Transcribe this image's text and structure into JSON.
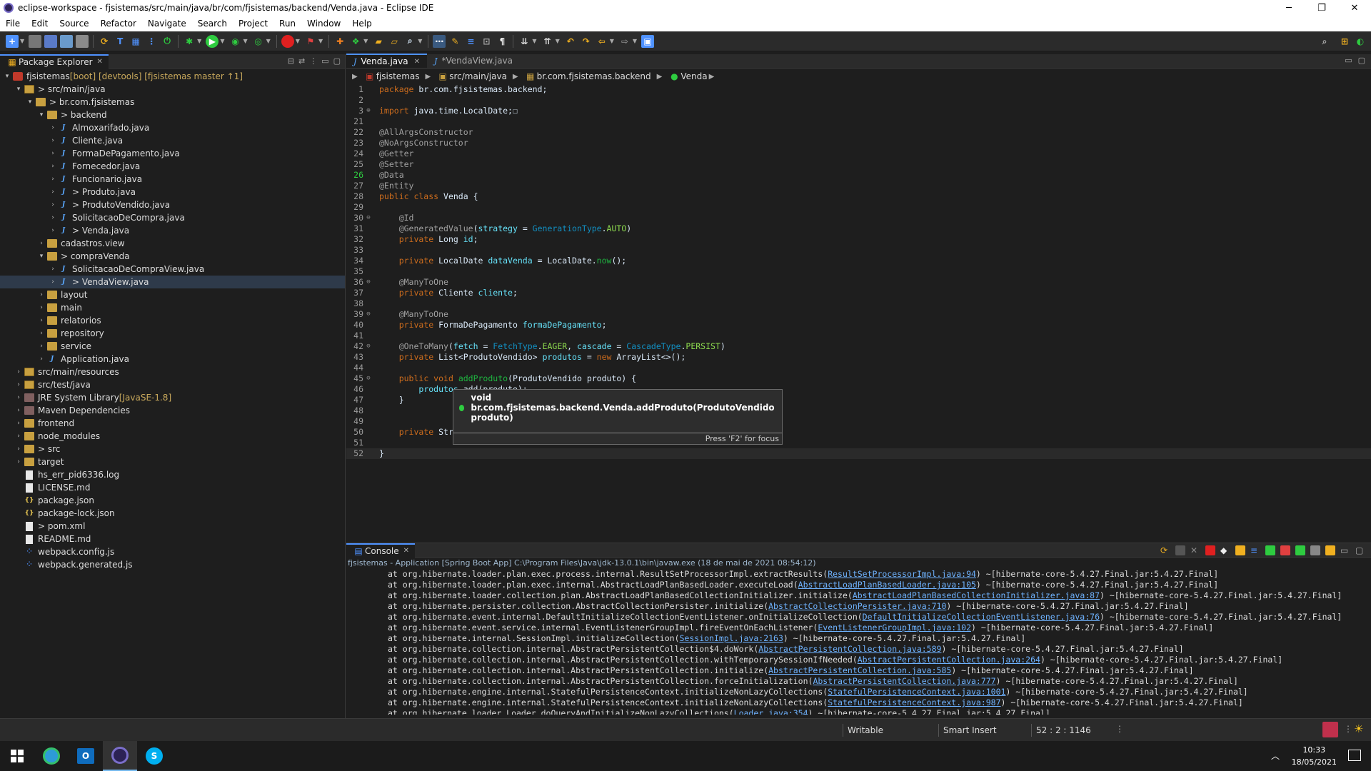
{
  "window": {
    "title": "eclipse-workspace - fjsistemas/src/main/java/br/com/fjsistemas/backend/Venda.java - Eclipse IDE",
    "minimize": "─",
    "maximize": "❐",
    "close": "✕"
  },
  "menu": [
    "File",
    "Edit",
    "Source",
    "Refactor",
    "Navigate",
    "Search",
    "Project",
    "Run",
    "Window",
    "Help"
  ],
  "package_explorer": {
    "title": "Package Explorer",
    "tree": [
      {
        "label": "fjsistemas",
        "deco": " [boot] [devtools] [fjsistemas master ↑1]",
        "icon": "project",
        "arrow": "▾",
        "indent": 0
      },
      {
        "label": "> src/main/java",
        "deco": "",
        "icon": "srcfolder",
        "arrow": "▾",
        "indent": 1
      },
      {
        "label": "> br.com.fjsistemas",
        "deco": "",
        "icon": "package",
        "arrow": "▾",
        "indent": 2
      },
      {
        "label": "> backend",
        "deco": "",
        "icon": "package",
        "arrow": "▾",
        "indent": 3
      },
      {
        "label": "Almoxarifado.java",
        "deco": "",
        "icon": "java",
        "arrow": "›",
        "indent": 4
      },
      {
        "label": "Cliente.java",
        "deco": "",
        "icon": "java",
        "arrow": "›",
        "indent": 4
      },
      {
        "label": "FormaDePagamento.java",
        "deco": "",
        "icon": "java",
        "arrow": "›",
        "indent": 4
      },
      {
        "label": "Fornecedor.java",
        "deco": "",
        "icon": "java",
        "arrow": "›",
        "indent": 4
      },
      {
        "label": "Funcionario.java",
        "deco": "",
        "icon": "java",
        "arrow": "›",
        "indent": 4
      },
      {
        "label": "> Produto.java",
        "deco": "",
        "icon": "java",
        "arrow": "›",
        "indent": 4
      },
      {
        "label": "> ProdutoVendido.java",
        "deco": "",
        "icon": "java",
        "arrow": "›",
        "indent": 4
      },
      {
        "label": "SolicitacaoDeCompra.java",
        "deco": "",
        "icon": "java",
        "arrow": "›",
        "indent": 4
      },
      {
        "label": "> Venda.java",
        "deco": "",
        "icon": "java",
        "arrow": "›",
        "indent": 4
      },
      {
        "label": "cadastros.view",
        "deco": "",
        "icon": "package",
        "arrow": "›",
        "indent": 3
      },
      {
        "label": "> compraVenda",
        "deco": "",
        "icon": "package",
        "arrow": "▾",
        "indent": 3
      },
      {
        "label": "SolicitacaoDeCompraView.java",
        "deco": "",
        "icon": "java",
        "arrow": "›",
        "indent": 4
      },
      {
        "label": "> VendaView.java",
        "deco": "",
        "icon": "java",
        "arrow": "›",
        "indent": 4,
        "selected": true
      },
      {
        "label": "layout",
        "deco": "",
        "icon": "package",
        "arrow": "›",
        "indent": 3
      },
      {
        "label": "main",
        "deco": "",
        "icon": "package",
        "arrow": "›",
        "indent": 3
      },
      {
        "label": "relatorios",
        "deco": "",
        "icon": "package",
        "arrow": "›",
        "indent": 3
      },
      {
        "label": "repository",
        "deco": "",
        "icon": "package",
        "arrow": "›",
        "indent": 3
      },
      {
        "label": "service",
        "deco": "",
        "icon": "package",
        "arrow": "›",
        "indent": 3
      },
      {
        "label": "Application.java",
        "deco": "",
        "icon": "java",
        "arrow": "›",
        "indent": 3
      },
      {
        "label": "src/main/resources",
        "deco": "",
        "icon": "srcfolder",
        "arrow": "›",
        "indent": 1
      },
      {
        "label": "src/test/java",
        "deco": "",
        "icon": "srcfolder",
        "arrow": "›",
        "indent": 1
      },
      {
        "label": "JRE System Library",
        "deco": " [JavaSE-1.8]",
        "icon": "library",
        "arrow": "›",
        "indent": 1
      },
      {
        "label": "Maven Dependencies",
        "deco": "",
        "icon": "library",
        "arrow": "›",
        "indent": 1
      },
      {
        "label": "frontend",
        "deco": "",
        "icon": "folder",
        "arrow": "›",
        "indent": 1
      },
      {
        "label": "node_modules",
        "deco": "",
        "icon": "folder",
        "arrow": "›",
        "indent": 1
      },
      {
        "label": "> src",
        "deco": "",
        "icon": "folder",
        "arrow": "›",
        "indent": 1
      },
      {
        "label": "target",
        "deco": "",
        "icon": "folder",
        "arrow": "›",
        "indent": 1
      },
      {
        "label": "hs_err_pid6336.log",
        "deco": "",
        "icon": "file",
        "arrow": "",
        "indent": 1
      },
      {
        "label": "LICENSE.md",
        "deco": "",
        "icon": "file",
        "arrow": "",
        "indent": 1
      },
      {
        "label": "package.json",
        "deco": "",
        "icon": "json",
        "arrow": "",
        "indent": 1
      },
      {
        "label": "package-lock.json",
        "deco": "",
        "icon": "json",
        "arrow": "",
        "indent": 1
      },
      {
        "label": "> pom.xml",
        "deco": "",
        "icon": "file",
        "arrow": "",
        "indent": 1
      },
      {
        "label": "README.md",
        "deco": "",
        "icon": "file",
        "arrow": "",
        "indent": 1
      },
      {
        "label": "webpack.config.js",
        "deco": "",
        "icon": "js",
        "arrow": "",
        "indent": 1
      },
      {
        "label": "webpack.generated.js",
        "deco": "",
        "icon": "js",
        "arrow": "",
        "indent": 1
      }
    ]
  },
  "editor": {
    "tabs": [
      {
        "label": "Venda.java",
        "active": true,
        "closable": true
      },
      {
        "label": "*VendaView.java",
        "active": false,
        "closable": false
      }
    ],
    "breadcrumb": [
      "fjsistemas",
      "src/main/java",
      "br.com.fjsistemas.backend",
      "Venda"
    ],
    "lines": [
      {
        "n": "1",
        "fold": "",
        "tokens": [
          [
            "kw",
            "package"
          ],
          [
            "pl",
            " br.com.fjsistemas.backend;"
          ]
        ]
      },
      {
        "n": "2",
        "fold": "",
        "tokens": []
      },
      {
        "n": "3",
        "fold": "⊕",
        "tokens": [
          [
            "kw",
            "import"
          ],
          [
            "pl",
            " java.time.LocalDate;"
          ],
          [
            "pl",
            "☐"
          ]
        ]
      },
      {
        "n": "21",
        "fold": "",
        "tokens": []
      },
      {
        "n": "22",
        "fold": "",
        "tokens": [
          [
            "an",
            "@AllArgsConstructor"
          ]
        ]
      },
      {
        "n": "23",
        "fold": "",
        "tokens": [
          [
            "an",
            "@NoArgsConstructor"
          ]
        ]
      },
      {
        "n": "24",
        "fold": "",
        "tokens": [
          [
            "an",
            "@Getter"
          ]
        ]
      },
      {
        "n": "25",
        "fold": "",
        "tokens": [
          [
            "an",
            "@Setter"
          ]
        ]
      },
      {
        "n": "26",
        "fold": "",
        "marker": true,
        "tokens": [
          [
            "an",
            "@Data"
          ]
        ]
      },
      {
        "n": "27",
        "fold": "",
        "tokens": [
          [
            "an",
            "@Entity"
          ]
        ]
      },
      {
        "n": "28",
        "fold": "",
        "tokens": [
          [
            "kw",
            "public class"
          ],
          [
            "pl",
            " Venda "
          ],
          [
            "pl",
            "{"
          ]
        ]
      },
      {
        "n": "29",
        "fold": "",
        "tokens": []
      },
      {
        "n": "30",
        "fold": "⊖",
        "tokens": [
          [
            "pl",
            "    "
          ],
          [
            "an",
            "@Id"
          ]
        ]
      },
      {
        "n": "31",
        "fold": "",
        "tokens": [
          [
            "pl",
            "    "
          ],
          [
            "an",
            "@GeneratedValue"
          ],
          [
            "pl",
            "("
          ],
          [
            "fd",
            "strategy"
          ],
          [
            "pl",
            " = "
          ],
          [
            "ty",
            "GenerationType"
          ],
          [
            "pl",
            "."
          ],
          [
            "st",
            "AUTO"
          ],
          [
            "pl",
            ")"
          ]
        ]
      },
      {
        "n": "32",
        "fold": "",
        "tokens": [
          [
            "pl",
            "    "
          ],
          [
            "kw",
            "private"
          ],
          [
            "pl",
            " Long "
          ],
          [
            "fd",
            "id"
          ],
          [
            "pl",
            ";"
          ]
        ]
      },
      {
        "n": "33",
        "fold": "",
        "tokens": []
      },
      {
        "n": "34",
        "fold": "",
        "tokens": [
          [
            "pl",
            "    "
          ],
          [
            "kw",
            "private"
          ],
          [
            "pl",
            " LocalDate "
          ],
          [
            "fd",
            "dataVenda"
          ],
          [
            "pl",
            " = LocalDate."
          ],
          [
            "mt",
            "now"
          ],
          [
            "pl",
            "();"
          ]
        ]
      },
      {
        "n": "35",
        "fold": "",
        "tokens": []
      },
      {
        "n": "36",
        "fold": "⊖",
        "tokens": [
          [
            "pl",
            "    "
          ],
          [
            "an",
            "@ManyToOne"
          ]
        ]
      },
      {
        "n": "37",
        "fold": "",
        "tokens": [
          [
            "pl",
            "    "
          ],
          [
            "kw",
            "private"
          ],
          [
            "pl",
            " Cliente "
          ],
          [
            "fd",
            "cliente"
          ],
          [
            "pl",
            ";"
          ]
        ]
      },
      {
        "n": "38",
        "fold": "",
        "tokens": []
      },
      {
        "n": "39",
        "fold": "⊖",
        "tokens": [
          [
            "pl",
            "    "
          ],
          [
            "an",
            "@ManyToOne"
          ]
        ]
      },
      {
        "n": "40",
        "fold": "",
        "tokens": [
          [
            "pl",
            "    "
          ],
          [
            "kw",
            "private"
          ],
          [
            "pl",
            " FormaDePagamento "
          ],
          [
            "fd",
            "formaDePagamento"
          ],
          [
            "pl",
            ";"
          ]
        ]
      },
      {
        "n": "41",
        "fold": "",
        "tokens": []
      },
      {
        "n": "42",
        "fold": "⊖",
        "tokens": [
          [
            "pl",
            "    "
          ],
          [
            "an",
            "@OneToMany"
          ],
          [
            "pl",
            "("
          ],
          [
            "fd",
            "fetch"
          ],
          [
            "pl",
            " = "
          ],
          [
            "ty",
            "FetchType"
          ],
          [
            "pl",
            "."
          ],
          [
            "st",
            "EAGER"
          ],
          [
            "pl",
            ", "
          ],
          [
            "fd",
            "cascade"
          ],
          [
            "pl",
            " = "
          ],
          [
            "ty",
            "CascadeType"
          ],
          [
            "pl",
            "."
          ],
          [
            "st",
            "PERSIST"
          ],
          [
            "pl",
            ")"
          ]
        ]
      },
      {
        "n": "43",
        "fold": "",
        "tokens": [
          [
            "pl",
            "    "
          ],
          [
            "kw",
            "private"
          ],
          [
            "pl",
            " List<ProdutoVendido> "
          ],
          [
            "fd",
            "produtos"
          ],
          [
            "pl",
            " = "
          ],
          [
            "kw",
            "new"
          ],
          [
            "pl",
            " ArrayList<>();"
          ]
        ]
      },
      {
        "n": "44",
        "fold": "",
        "tokens": []
      },
      {
        "n": "45",
        "fold": "⊖",
        "tokens": [
          [
            "pl",
            "    "
          ],
          [
            "kw",
            "public void"
          ],
          [
            "pl",
            " "
          ],
          [
            "mt",
            "addProduto"
          ],
          [
            "pl",
            "(ProdutoVendido produto) {"
          ]
        ]
      },
      {
        "n": "46",
        "fold": "",
        "tokens": [
          [
            "pl",
            "        "
          ],
          [
            "fd",
            "produtos"
          ],
          [
            "pl",
            ".add(produto);"
          ]
        ]
      },
      {
        "n": "47",
        "fold": "",
        "tokens": [
          [
            "pl",
            "    }"
          ]
        ]
      },
      {
        "n": "48",
        "fold": "",
        "tokens": []
      },
      {
        "n": "49",
        "fold": "",
        "tokens": []
      },
      {
        "n": "50",
        "fold": "",
        "tokens": [
          [
            "pl",
            "    "
          ],
          [
            "kw",
            "private"
          ],
          [
            "pl",
            " String "
          ],
          [
            "fd",
            "obs"
          ],
          [
            "pl",
            ";"
          ]
        ]
      },
      {
        "n": "51",
        "fold": "",
        "tokens": []
      },
      {
        "n": "52",
        "fold": "",
        "current": true,
        "tokens": [
          [
            "pl",
            "}"
          ]
        ]
      }
    ],
    "hover": {
      "signature": "void br.com.fjsistemas.backend.Venda.addProduto(ProdutoVendido produto)",
      "footer": "Press 'F2' for focus"
    }
  },
  "console": {
    "title": "Console",
    "description": "fjsistemas - Application [Spring Boot App] C:\\Program Files\\Java\\jdk-13.0.1\\bin\\javaw.exe  (18 de mai de 2021 08:54:12)",
    "lines": [
      {
        "pre": "at org.hibernate.loader.plan.exec.process.internal.ResultSetProcessorImpl.extractResults(",
        "link": "ResultSetProcessorImpl.java:94",
        "post": ") ~[hibernate-core-5.4.27.Final.jar:5.4.27.Final]"
      },
      {
        "pre": "at org.hibernate.loader.plan.exec.internal.AbstractLoadPlanBasedLoader.executeLoad(",
        "link": "AbstractLoadPlanBasedLoader.java:105",
        "post": ") ~[hibernate-core-5.4.27.Final.jar:5.4.27.Final]"
      },
      {
        "pre": "at org.hibernate.loader.collection.plan.AbstractLoadPlanBasedCollectionInitializer.initialize(",
        "link": "AbstractLoadPlanBasedCollectionInitializer.java:87",
        "post": ") ~[hibernate-core-5.4.27.Final.jar:5.4.27.Final]"
      },
      {
        "pre": "at org.hibernate.persister.collection.AbstractCollectionPersister.initialize(",
        "link": "AbstractCollectionPersister.java:710",
        "post": ") ~[hibernate-core-5.4.27.Final.jar:5.4.27.Final]"
      },
      {
        "pre": "at org.hibernate.event.internal.DefaultInitializeCollectionEventListener.onInitializeCollection(",
        "link": "DefaultInitializeCollectionEventListener.java:76",
        "post": ") ~[hibernate-core-5.4.27.Final.jar:5.4.27.Final]"
      },
      {
        "pre": "at org.hibernate.event.service.internal.EventListenerGroupImpl.fireEventOnEachListener(",
        "link": "EventListenerGroupImpl.java:102",
        "post": ") ~[hibernate-core-5.4.27.Final.jar:5.4.27.Final]"
      },
      {
        "pre": "at org.hibernate.internal.SessionImpl.initializeCollection(",
        "link": "SessionImpl.java:2163",
        "post": ") ~[hibernate-core-5.4.27.Final.jar:5.4.27.Final]"
      },
      {
        "pre": "at org.hibernate.collection.internal.AbstractPersistentCollection$4.doWork(",
        "link": "AbstractPersistentCollection.java:589",
        "post": ") ~[hibernate-core-5.4.27.Final.jar:5.4.27.Final]"
      },
      {
        "pre": "at org.hibernate.collection.internal.AbstractPersistentCollection.withTemporarySessionIfNeeded(",
        "link": "AbstractPersistentCollection.java:264",
        "post": ") ~[hibernate-core-5.4.27.Final.jar:5.4.27.Final]"
      },
      {
        "pre": "at org.hibernate.collection.internal.AbstractPersistentCollection.initialize(",
        "link": "AbstractPersistentCollection.java:585",
        "post": ") ~[hibernate-core-5.4.27.Final.jar:5.4.27.Final]"
      },
      {
        "pre": "at org.hibernate.collection.internal.AbstractPersistentCollection.forceInitialization(",
        "link": "AbstractPersistentCollection.java:777",
        "post": ") ~[hibernate-core-5.4.27.Final.jar:5.4.27.Final]"
      },
      {
        "pre": "at org.hibernate.engine.internal.StatefulPersistenceContext.initializeNonLazyCollections(",
        "link": "StatefulPersistenceContext.java:1001",
        "post": ") ~[hibernate-core-5.4.27.Final.jar:5.4.27.Final]"
      },
      {
        "pre": "at org.hibernate.engine.internal.StatefulPersistenceContext.initializeNonLazyCollections(",
        "link": "StatefulPersistenceContext.java:987",
        "post": ") ~[hibernate-core-5.4.27.Final.jar:5.4.27.Final]"
      },
      {
        "pre": "at org.hibernate.loader.Loader.doQueryAndInitializeNonLazyCollections(",
        "link": "Loader.java:354",
        "post": ") ~[hibernate-core-5.4.27.Final.jar:5.4.27.Final]"
      }
    ]
  },
  "status": {
    "writable": "Writable",
    "insert_mode": "Smart Insert",
    "position": "52 : 2 : 1146"
  },
  "taskbar": {
    "time": "10:33",
    "date": "18/05/2021"
  }
}
